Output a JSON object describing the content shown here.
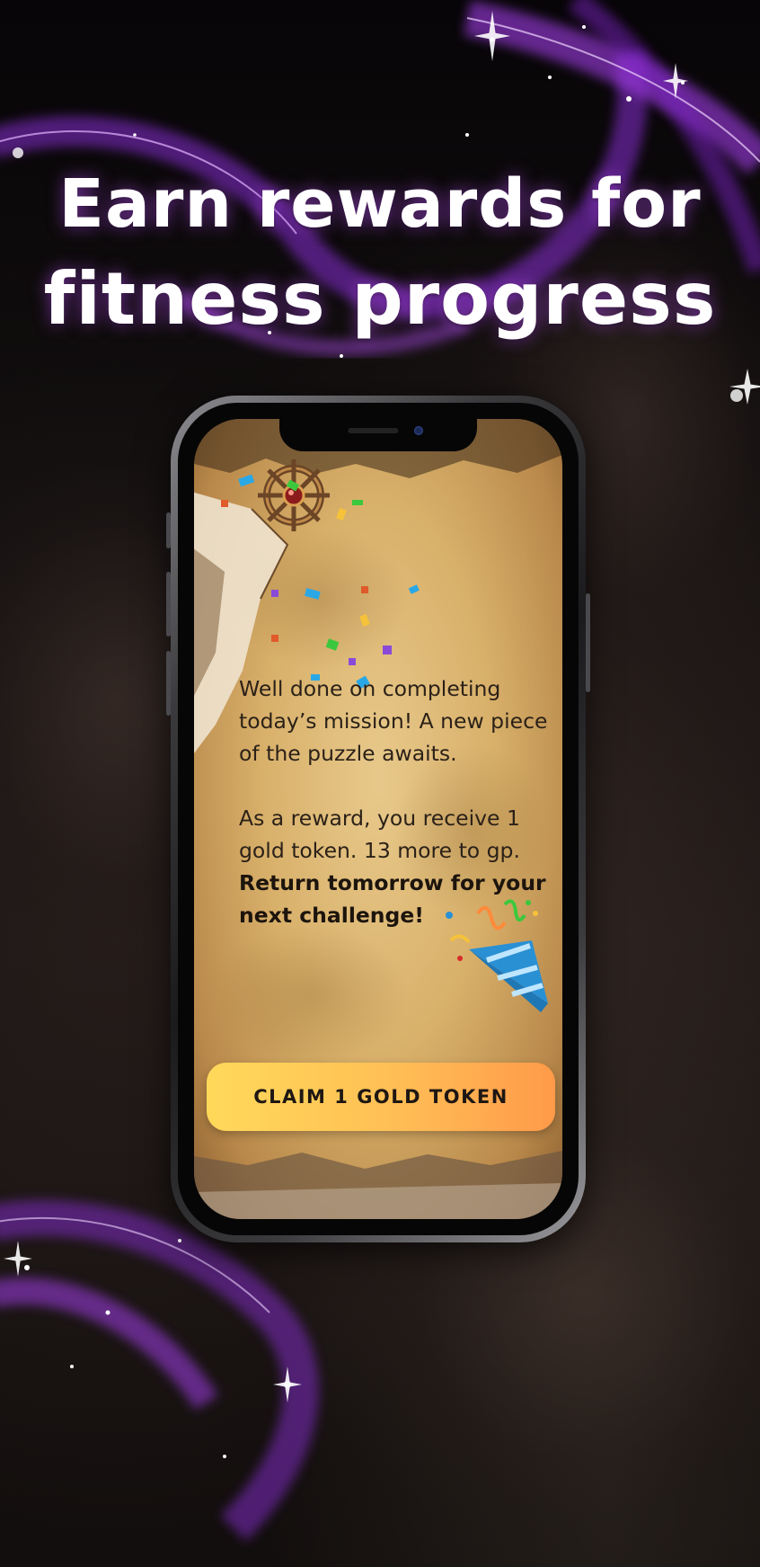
{
  "headline": {
    "line1": "Earn rewards for",
    "line2": "fitness progress"
  },
  "screen": {
    "message": {
      "line1": "Well done on completing",
      "line2": "today’s mission! A new piece",
      "line3": "of the puzzle awaits.",
      "line4": "As a reward, you receive 1",
      "line5": "gold token. 13 more to gp.",
      "bold_line1": "Return tomorrow for your",
      "bold_line2": "next challenge!"
    },
    "claim_button_label": "CLAIM 1 GOLD TOKEN"
  },
  "colors": {
    "swirl": "#a23ee8",
    "button_start": "#ffd95a",
    "button_end": "#ff9a4a",
    "parchment": "#d8b06a"
  },
  "icons": [
    "ship-wheel-icon",
    "party-popper-icon",
    "confetti-icon"
  ]
}
